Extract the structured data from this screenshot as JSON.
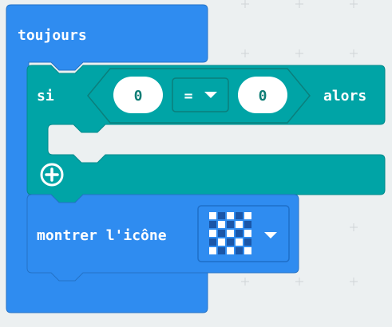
{
  "blocks": {
    "forever": {
      "label": "toujours",
      "color": "#2f8cf0"
    },
    "if": {
      "label_if": "si",
      "label_then": "alors",
      "color": "#00a4a6",
      "add_icon": "plus-circle-icon"
    },
    "compare": {
      "left_value": "0",
      "operator": "=",
      "right_value": "0",
      "dropdown_icon": "triangle-down-icon"
    },
    "show_icon": {
      "label": "montrer l'icône",
      "icon_pattern": "checkerboard-led-icon",
      "dropdown_icon": "triangle-down-icon",
      "color": "#2f8cf0"
    }
  }
}
